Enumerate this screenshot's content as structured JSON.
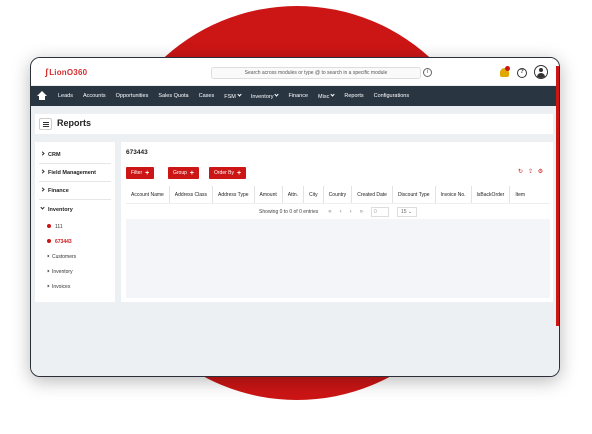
{
  "app": {
    "logo_text": "LionO360",
    "search_placeholder": "Search across modules or type @ to search in a specific module",
    "info_icon": "i",
    "help_icon": "?"
  },
  "nav": {
    "items": [
      {
        "label": "Leads",
        "dropdown": false
      },
      {
        "label": "Accounts",
        "dropdown": false
      },
      {
        "label": "Opportunities",
        "dropdown": false
      },
      {
        "label": "Sales Quota",
        "dropdown": false
      },
      {
        "label": "Cases",
        "dropdown": false
      },
      {
        "label": "FSM",
        "dropdown": true
      },
      {
        "label": "Inventory",
        "dropdown": true
      },
      {
        "label": "Finance",
        "dropdown": false
      },
      {
        "label": "Misc",
        "dropdown": true
      },
      {
        "label": "Reports",
        "dropdown": false
      },
      {
        "label": "Configurations",
        "dropdown": false
      }
    ]
  },
  "page": {
    "title": "Reports"
  },
  "sidebar": {
    "sections": [
      "CRM",
      "Field Management",
      "Finance",
      "Inventory"
    ],
    "subitems": [
      {
        "label": "111",
        "type": "dot"
      },
      {
        "label": "673443",
        "type": "dot-active"
      },
      {
        "label": "Customers",
        "type": "chevron"
      },
      {
        "label": "Inventory",
        "type": "chevron"
      },
      {
        "label": "Invoices",
        "type": "chevron"
      }
    ]
  },
  "report": {
    "name": "673443",
    "filter_label": "Filter",
    "group_label": "Group",
    "orderby_label": "Order By",
    "plus": "+",
    "refresh_icon": "↻",
    "export_icon": "⇪",
    "settings_icon": "⚙",
    "columns": [
      "Account Name",
      "Address Class",
      "Address Type",
      "Amount",
      "Attn.",
      "City",
      "Country",
      "Created Date",
      "Discount Type",
      "Invoice No.",
      "IsBackOrder",
      "Item"
    ],
    "pager_text": "Showing 0 to 0 of 0 entries",
    "first": "«",
    "prev": "‹",
    "next": "›",
    "last": "»",
    "page_value": "0",
    "page_size": "15"
  },
  "colors": {
    "accent": "#cc1515",
    "nav_bg": "#2a3542",
    "content_bg": "#edf0f3"
  }
}
